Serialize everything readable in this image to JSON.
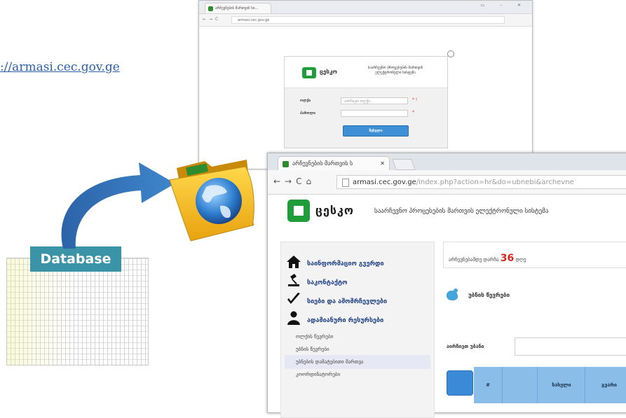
{
  "link": {
    "url": "://armasi.cec.gov.ge"
  },
  "database": {
    "label": "Database"
  },
  "login_window": {
    "tab_title": "არჩევნების მართვის სი...",
    "url": "armasi.cec.gov.ge",
    "brand": "ცესკო",
    "subtitle": "საარჩევნო პროცესების მართვის ელექტრონული სისტემა",
    "user_label": "ოლქი",
    "user_placeholder": "აირჩიეთ ოლქი...",
    "password_label": "პაროლი",
    "submit_label": "შესვლა"
  },
  "main_window": {
    "tab_title": "არჩევნების მართვის ს",
    "url_domain": "armasi.cec.gov.ge",
    "url_path": "/index.php?action=hr&do=ubnebi&archevne",
    "brand": "ცესკო",
    "brand_subtitle": "საარჩევნო პროცესების მართვის ელექტრონული სისტემა",
    "menu": [
      {
        "label": "საინფორმაციო გვერდი",
        "icon": "home-icon"
      },
      {
        "label": "საკონტაქტო",
        "icon": "gavel-icon"
      },
      {
        "label": "სიები და ამომრჩევლები",
        "icon": "check-icon"
      },
      {
        "label": "ადამიანური რესურსები",
        "icon": "user-icon"
      }
    ],
    "submenu": [
      "ოლქის წევრები",
      "უბნის წევრები",
      "უბნების დამატებითი მართვა",
      "კოორდინატორები"
    ],
    "days_label": "არჩევნებამდე დარჩა",
    "days_count": "36",
    "days_unit": "დღე",
    "lists_title": "უბნის წევრები",
    "select_label": "აირჩიეთ უბანი",
    "table_headers": [
      "#",
      "",
      "სახელი",
      "გვარი"
    ]
  }
}
